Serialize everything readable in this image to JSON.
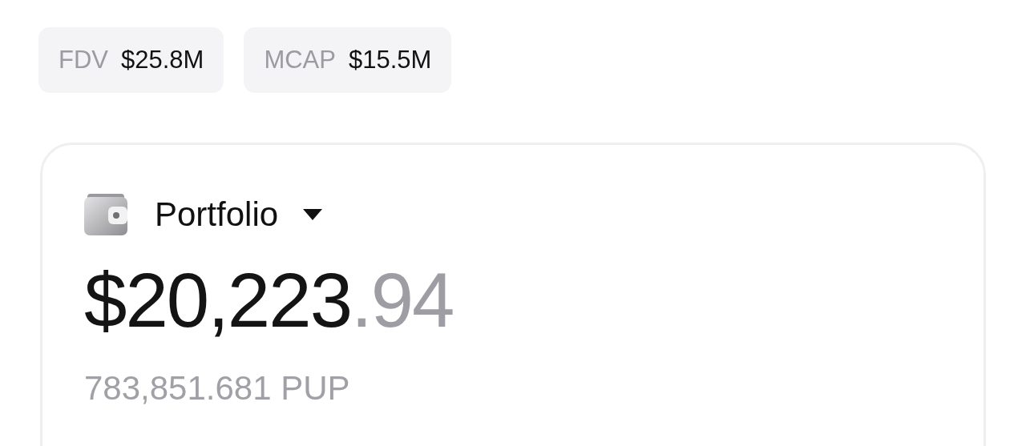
{
  "stats": [
    {
      "label": "FDV",
      "value": "$25.8M"
    },
    {
      "label": "MCAP",
      "value": "$15.5M"
    }
  ],
  "portfolio": {
    "title": "Portfolio",
    "balance_whole": "$20,223",
    "balance_fraction": ".94",
    "token_amount": "783,851.681 PUP"
  }
}
